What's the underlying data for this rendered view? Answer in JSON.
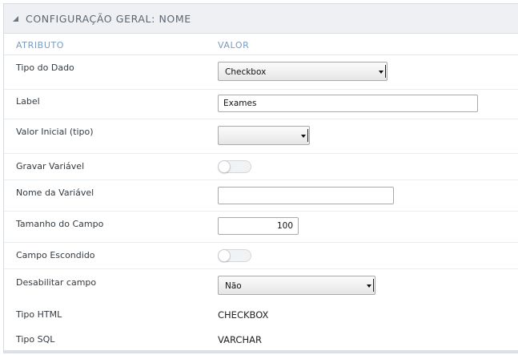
{
  "panel": {
    "title": "CONFIGURAÇÃO GERAL: NOME",
    "col_attr": "ATRIBUTO",
    "col_value": "VALOR"
  },
  "rows": {
    "tipo_dado": {
      "label": "Tipo do Dado",
      "value": "Checkbox"
    },
    "label": {
      "label": "Label",
      "value": "Exames"
    },
    "valor_inicial": {
      "label": "Valor Inicial (tipo)",
      "value": ""
    },
    "gravar_variavel": {
      "label": "Gravar Variável",
      "checked": false
    },
    "nome_variavel": {
      "label": "Nome da Variável",
      "value": ""
    },
    "tamanho_campo": {
      "label": "Tamanho do Campo",
      "value": "100"
    },
    "campo_escondido": {
      "label": "Campo Escondido",
      "checked": false
    },
    "desabilitar_campo": {
      "label": "Desabilitar campo",
      "value": "Não"
    },
    "tipo_html": {
      "label": "Tipo HTML",
      "value": "CHECKBOX"
    },
    "tipo_sql": {
      "label": "Tipo SQL",
      "value": "VARCHAR"
    }
  },
  "colors": {
    "header_bg": "#eef0f4",
    "column_header_text": "#7a9cc0",
    "label_text": "#333a40"
  }
}
